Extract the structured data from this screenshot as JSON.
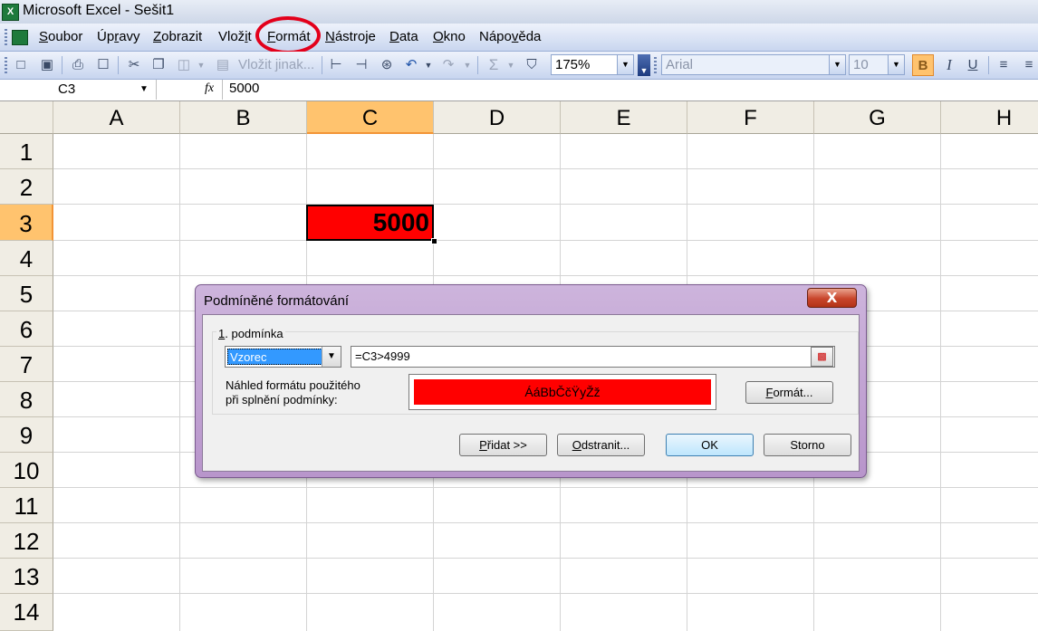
{
  "window": {
    "title": "Microsoft Excel - Sešit1",
    "app_icon": "X"
  },
  "menu": {
    "items": [
      {
        "pre": "",
        "u": "S",
        "post": "oubor"
      },
      {
        "pre": "Úp",
        "u": "r",
        "post": "avy"
      },
      {
        "pre": "",
        "u": "Z",
        "post": "obrazit"
      },
      {
        "pre": "Vlož",
        "u": "i",
        "post": "t"
      },
      {
        "pre": "",
        "u": "F",
        "post": "ormát"
      },
      {
        "pre": "",
        "u": "N",
        "post": "ástroje"
      },
      {
        "pre": "",
        "u": "D",
        "post": "ata"
      },
      {
        "pre": "",
        "u": "O",
        "post": "kno"
      },
      {
        "pre": "Nápo",
        "u": "v",
        "post": "ěda"
      }
    ],
    "highlighted_item": "Formát",
    "highlight_color": "#e3001b"
  },
  "toolbar": {
    "paste_special_label": "Vložit jinak...",
    "zoom": "175%",
    "font_name": "Arial",
    "font_size": "10",
    "icons": [
      "new-icon",
      "open-icon",
      "save-icon",
      "print-icon",
      "print-preview-icon",
      "cut-icon",
      "copy-icon",
      "paste-icon",
      "undo-icon",
      "redo-icon",
      "autosum-icon",
      "find-icon",
      "bold-icon",
      "italic-icon",
      "underline-icon",
      "align-left-icon",
      "align-justify-icon"
    ]
  },
  "formula_bar": {
    "name_box": "C3",
    "fx_label": "fx",
    "content": "5000"
  },
  "sheet": {
    "columns": [
      "A",
      "B",
      "C",
      "D",
      "E",
      "F",
      "G",
      "H"
    ],
    "rows": [
      "1",
      "2",
      "3",
      "4",
      "5",
      "6",
      "7",
      "8",
      "9",
      "10",
      "11",
      "12",
      "13",
      "14"
    ],
    "selected_column": "C",
    "selected_row": "3",
    "active_cell": {
      "ref": "C3",
      "value": "5000",
      "fill": "#ff0000",
      "bold": true
    }
  },
  "dialog": {
    "title": "Podmíněné formátování",
    "close_label": "X",
    "condition_group": {
      "label_u": "1",
      "label_rest": ". podmínka"
    },
    "condition_type": "Vzorec",
    "formula": "=C3>4999",
    "preview_label_line1": "Náhled formátu použitého",
    "preview_label_line2": "při splnění podmínky:",
    "preview_text": "ÁáBbČčŸyŽž",
    "preview_fill": "#ff0000",
    "format_button": {
      "u": "F",
      "rest": "ormát..."
    },
    "add_button": {
      "u": "P",
      "rest": "řidat >>"
    },
    "remove_button": {
      "u": "O",
      "rest": "dstranit..."
    },
    "ok_button": "OK",
    "cancel_button": "Storno"
  }
}
